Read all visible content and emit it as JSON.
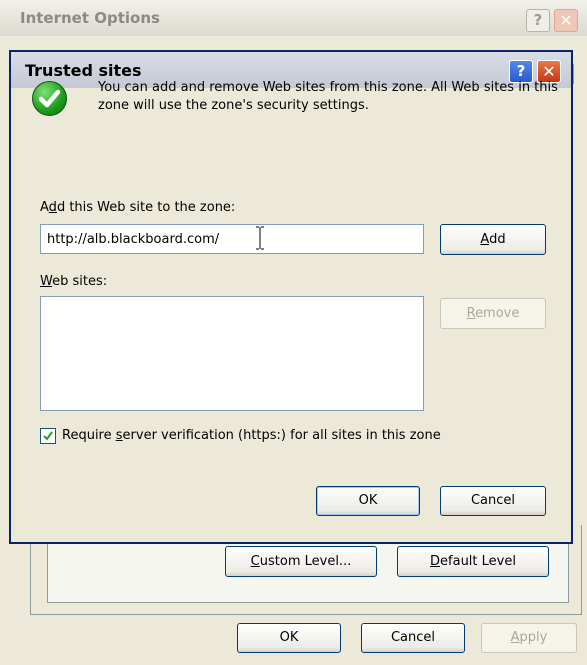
{
  "background_window": {
    "title": "Internet Options",
    "title_help": "?",
    "title_close": "✕",
    "custom_level_prefix": "",
    "custom_level_accel": "C",
    "custom_level_rest": "ustom Level...",
    "default_level_prefix": "",
    "default_level_accel": "D",
    "default_level_rest": "efault Level",
    "ok_label": "OK",
    "cancel_label": "Cancel",
    "apply_accel": "A",
    "apply_rest": "pply"
  },
  "dialog": {
    "title": "Trusted sites",
    "title_help": "?",
    "title_close": "✕",
    "info_text": "You can add and remove Web sites from this zone. All Web sites in this zone will use the zone's security settings.",
    "add_label_prefix": "A",
    "add_label_accel": "d",
    "add_label_rest": "d this Web site to the zone:",
    "url_value": "http://alb.blackboard.com/",
    "add_button_accel": "A",
    "add_button_rest": "dd",
    "websites_label_accel": "W",
    "websites_label_rest": "eb sites:",
    "websites": [],
    "remove_button_accel": "R",
    "remove_button_rest": "emove",
    "https_checkbox_checked": true,
    "https_label_prefix": "Require ",
    "https_label_accel": "s",
    "https_label_rest": "erver verification (https:) for all sites in this zone",
    "ok_label": "OK",
    "cancel_label": "Cancel"
  },
  "colors": {
    "titlebar_active": "#c4c9d5",
    "dialog_bg": "#ece9d8",
    "button_border": "#003c74",
    "check_green": "#1d9a1d"
  },
  "icons": {
    "info": "checkmark-icon",
    "text_cursor": "text-cursor-icon"
  }
}
